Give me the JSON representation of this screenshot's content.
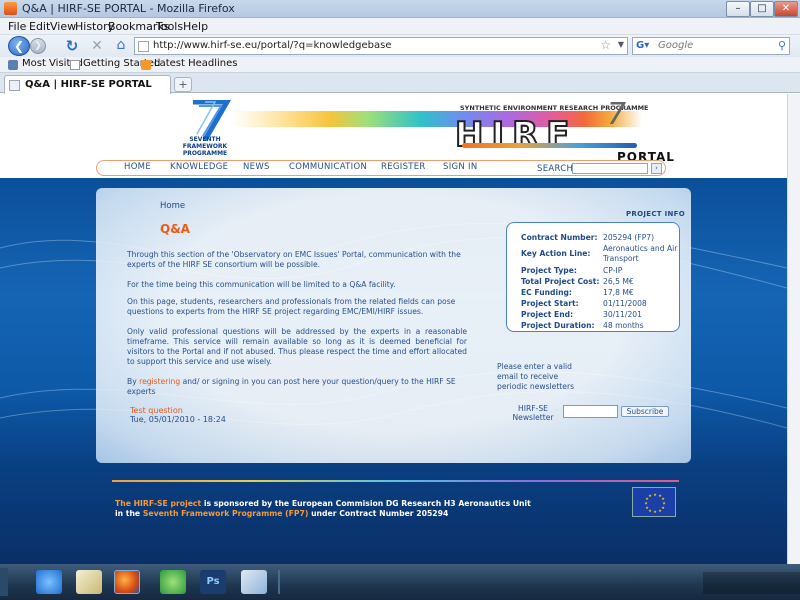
{
  "window": {
    "title": "Q&A | HIRF-SE PORTAL - Mozilla Firefox",
    "minimize": "–",
    "maximize": "□",
    "close": "✕"
  },
  "menu": [
    "File",
    "Edit",
    "View",
    "History",
    "Bookmarks",
    "Tools",
    "Help"
  ],
  "address": {
    "url": "http://www.hirf-se.eu/portal/?q=knowledgebase",
    "search_placeholder": "Google"
  },
  "bookmarks": [
    "Most Visited",
    "Getting Started",
    "Latest Headlines"
  ],
  "tabs": [
    {
      "label": "Q&A | HIRF-SE PORTAL"
    }
  ],
  "tab_new": "+",
  "header": {
    "fp7_line1": "SEVENTH FRAMEWORK",
    "fp7_line2": "PROGRAMME",
    "serp": "SYNTHETIC ENVIRONMENT RESEARCH PROGRAMME",
    "hirf": "HIRF",
    "seven": "7",
    "portal": "PORTAL"
  },
  "nav": {
    "items": [
      "HOME",
      "KNOWLEDGE",
      "NEWS",
      "COMMUNICATION",
      "REGISTER",
      "SIGN IN"
    ],
    "search_label": "SEARCH",
    "search_go": "›"
  },
  "page": {
    "breadcrumb": "Home",
    "title": "Q&A",
    "para1": "Through this section of the 'Observatory on EMC Issues' Portal, communication with the experts of the HIRF SE consortium will be possible.",
    "para2": "For the time being this communication will be limited to a Q&A facility.",
    "para3": "On this page, students, researchers and professionals from the related fields can pose questions to experts from the HIRF SE project regarding EMC/EMI/HIRF issues.",
    "para4": "Only valid professional questions will be addressed by the experts in a reasonable timeframe. This service will remain available so long as it is deemed beneficial for visitors to the Portal and if not abused. Thus please respect the time and effort allocated to support this service and use wisely.",
    "para5_pre": "By ",
    "para5_link": "registering",
    "para5_post": " and/ or signing in you can post here your question/query to the HIRF SE experts",
    "test_question": "Test question",
    "test_date": "Tue, 05/01/2010 - 18:24"
  },
  "project_info": {
    "heading": "PROJECT INFO",
    "rows": [
      {
        "k": "Contract Number:",
        "v": "205294 (FP7)"
      },
      {
        "k": "Key Action Line:",
        "v": "Aeronautics and Air",
        "v2": "Transport"
      },
      {
        "k": "Project Type:",
        "v": "CP-IP"
      },
      {
        "k": "Total Project Cost:",
        "v": "26,5 M€"
      },
      {
        "k": "EC Funding:",
        "v": "17,8 M€"
      },
      {
        "k": "Project Start:",
        "v": "01/11/2008"
      },
      {
        "k": "Project End:",
        "v": "30/11/201"
      },
      {
        "k": "Project Duration:",
        "v": "48 months"
      }
    ]
  },
  "newsletter": {
    "prompt": "Please enter a valid email to receive periodic newsletters",
    "label": "HIRF-SE Newsletter",
    "button": "Subscribe"
  },
  "footer": {
    "l1_orange": "The HIRF-SE project",
    "l1_white": " is sponsored by the European Commision DG Research H3 Aeronautics Unit",
    "l2_white1": "in the ",
    "l2_orange": "Seventh Framework Programme (FP7)",
    "l2_white2": " under Contract Number 205294"
  },
  "taskbar": {
    "apps": [
      "internet-explorer",
      "notepad",
      "firefox",
      "messenger",
      "photoshop",
      "paint"
    ]
  },
  "colors": {
    "accent_orange": "#ef5a14",
    "link_blue": "#27508f",
    "band_blue": "#0d59a8"
  }
}
